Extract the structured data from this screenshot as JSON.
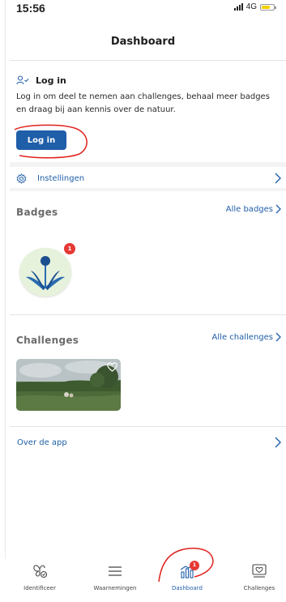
{
  "status_bar": {
    "time": "15:56",
    "network": "4G",
    "battery_level": 0.7
  },
  "header": {
    "title": "Dashboard"
  },
  "login": {
    "title": "Log in",
    "description": "Log in om deel te nemen aan challenges, behaal meer badges en draag bij aan kennis over de natuur.",
    "button_label": "Log in"
  },
  "settings": {
    "label": "Instellingen"
  },
  "badges": {
    "title": "Badges",
    "link": "Alle badges",
    "items": [
      {
        "count": "1"
      }
    ]
  },
  "challenges": {
    "title": "Challenges",
    "link": "Alle challenges"
  },
  "about": {
    "label": "Over de app"
  },
  "tabs": [
    {
      "label": "Identificeer",
      "icon": "butterfly-icon"
    },
    {
      "label": "Waarnemingen",
      "icon": "list-icon"
    },
    {
      "label": "Dashboard",
      "icon": "dashboard-chart-icon",
      "badge": "1",
      "active": true
    },
    {
      "label": "Challenges",
      "icon": "challenge-heart-icon"
    }
  ],
  "colors": {
    "accent": "#1f5ea8",
    "notification": "#e53935",
    "annotation": "#e0201b"
  }
}
